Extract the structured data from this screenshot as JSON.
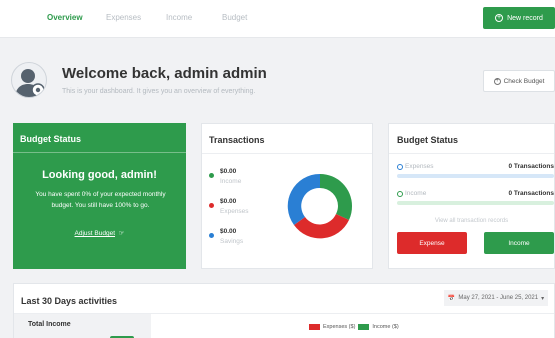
{
  "nav": {
    "tabs": [
      {
        "label": "Overview",
        "active": true
      },
      {
        "label": "Expenses",
        "active": false
      },
      {
        "label": "Income",
        "active": false
      },
      {
        "label": "Budget",
        "active": false
      }
    ],
    "new_record_label": "New record",
    "new_record_icon": "plus-circle-icon"
  },
  "welcome": {
    "title": "Welcome back, admin admin",
    "subtitle": "This is your dashboard. It gives you an overview of everything.",
    "check_budget_label": "Check Budget",
    "check_budget_icon": "plus-circle-icon",
    "avatar_icon": "user-gear-icon"
  },
  "budget_card": {
    "title": "Budget Status",
    "headline": "Looking good, admin!",
    "message": "You have spent 0% of your expected monthly budget. You still have 100% to go.",
    "adjust_label": "Adjust Budget",
    "adjust_icon": "pointer-hand-icon"
  },
  "transactions": {
    "title": "Transactions",
    "items": [
      {
        "amount": "$0.00",
        "label": "Income",
        "color": "#2e9b4c"
      },
      {
        "amount": "$0.00",
        "label": "Expenses",
        "color": "#dd2b2b"
      },
      {
        "amount": "$0.00",
        "label": "Savings",
        "color": "#2a7fd4"
      }
    ],
    "donut_colors": [
      "#2e9b4c",
      "#dd2b2b",
      "#2a7fd4"
    ]
  },
  "budget_status": {
    "title": "Budget Status",
    "rows": [
      {
        "label": "Expenses",
        "count": "0 Transactions",
        "color": "#2a7fd4"
      },
      {
        "label": "Income",
        "count": "0 Transactions",
        "color": "#2e9b4c"
      }
    ],
    "view_all": "View all transaction records",
    "expense_button": "Expense",
    "income_button": "Income"
  },
  "activities": {
    "title": "Last 30 Days activities",
    "date_range": "May 27, 2021 - June 25, 2021",
    "calendar_icon": "calendar-icon",
    "caret_icon": "caret-down-icon",
    "total_income_label": "Total Income",
    "legend": [
      {
        "label": "Expenses ($)",
        "color": "#dd2b2b"
      },
      {
        "label": "Income ($)",
        "color": "#2e9b4c"
      }
    ]
  }
}
